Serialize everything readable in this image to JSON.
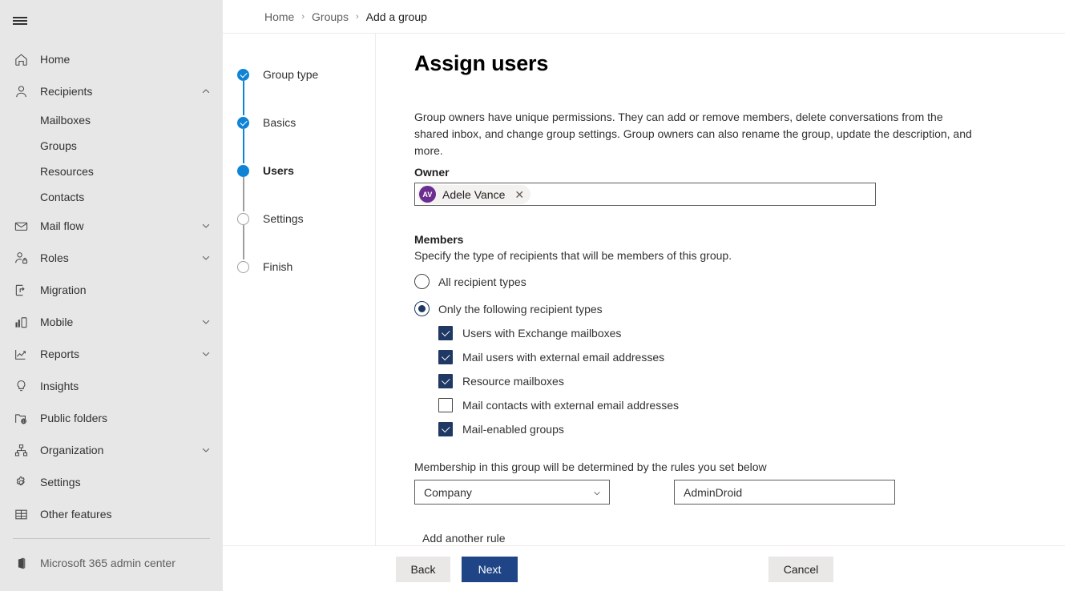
{
  "sidebar": {
    "menu_icon": "hamburger-icon",
    "items": [
      {
        "label": "Home",
        "icon": "home-icon",
        "expandable": false,
        "chevron": ""
      },
      {
        "label": "Recipients",
        "icon": "person-icon",
        "expandable": true,
        "chevron": "up"
      },
      {
        "label": "Mail flow",
        "icon": "envelope-icon",
        "expandable": true,
        "chevron": "down"
      },
      {
        "label": "Roles",
        "icon": "person-lock-icon",
        "expandable": true,
        "chevron": "down"
      },
      {
        "label": "Migration",
        "icon": "migration-icon",
        "expandable": false,
        "chevron": ""
      },
      {
        "label": "Mobile",
        "icon": "mobile-icon",
        "expandable": true,
        "chevron": "down"
      },
      {
        "label": "Reports",
        "icon": "reports-icon",
        "expandable": true,
        "chevron": "down"
      },
      {
        "label": "Insights",
        "icon": "lightbulb-icon",
        "expandable": false,
        "chevron": ""
      },
      {
        "label": "Public folders",
        "icon": "public-folder-icon",
        "expandable": false,
        "chevron": ""
      },
      {
        "label": "Organization",
        "icon": "org-chart-icon",
        "expandable": true,
        "chevron": "down"
      },
      {
        "label": "Settings",
        "icon": "gear-icon",
        "expandable": false,
        "chevron": ""
      },
      {
        "label": "Other features",
        "icon": "grid-icon",
        "expandable": false,
        "chevron": ""
      }
    ],
    "recipients_children": [
      "Mailboxes",
      "Groups",
      "Resources",
      "Contacts"
    ],
    "footer_link": {
      "label": "Microsoft 365 admin center",
      "icon": "office-icon"
    }
  },
  "breadcrumb": {
    "items": [
      "Home",
      "Groups",
      "Add a group"
    ],
    "separator": "›"
  },
  "wizard": {
    "steps": [
      {
        "label": "Group type",
        "state": "done"
      },
      {
        "label": "Basics",
        "state": "done"
      },
      {
        "label": "Users",
        "state": "current"
      },
      {
        "label": "Settings",
        "state": "todo"
      },
      {
        "label": "Finish",
        "state": "todo"
      }
    ]
  },
  "main": {
    "title": "Assign users",
    "intro": "Group owners have unique permissions. They can add or remove members, delete conversations from the shared inbox, and change group settings. Group owners can also rename the group, update the description, and more.",
    "owner": {
      "label": "Owner",
      "chip": {
        "initials": "AV",
        "name": "Adele Vance",
        "remove_icon": "close-icon"
      }
    },
    "members": {
      "heading": "Members",
      "subtext": "Specify the type of recipients that will be members of this group.",
      "radios": [
        {
          "label": "All recipient types",
          "selected": false
        },
        {
          "label": "Only the following recipient types",
          "selected": true
        }
      ],
      "checkboxes": [
        {
          "label": "Users with Exchange mailboxes",
          "checked": true
        },
        {
          "label": "Mail users with external email addresses",
          "checked": true
        },
        {
          "label": "Resource mailboxes",
          "checked": true
        },
        {
          "label": "Mail contacts with external email addresses",
          "checked": false
        },
        {
          "label": "Mail-enabled groups",
          "checked": true
        }
      ]
    },
    "rules": {
      "heading": "Membership in this group will be determined by the rules you set below",
      "attribute_select": {
        "value": "Company",
        "chevron_icon": "chevron-down-icon"
      },
      "value_input": {
        "value": "AdminDroid",
        "placeholder": ""
      },
      "add_another": "Add another rule"
    }
  },
  "footer": {
    "back": "Back",
    "next": "Next",
    "cancel": "Cancel"
  },
  "colors": {
    "sidebar_bg": "#e7e7e7",
    "step_active": "#0f83d6",
    "step_inactive": "#a19f9d",
    "control_accent": "#1f3864",
    "primary_button": "#1f4587",
    "avatar": "#6b2d8f",
    "neutral_button": "#e9e8e7"
  }
}
